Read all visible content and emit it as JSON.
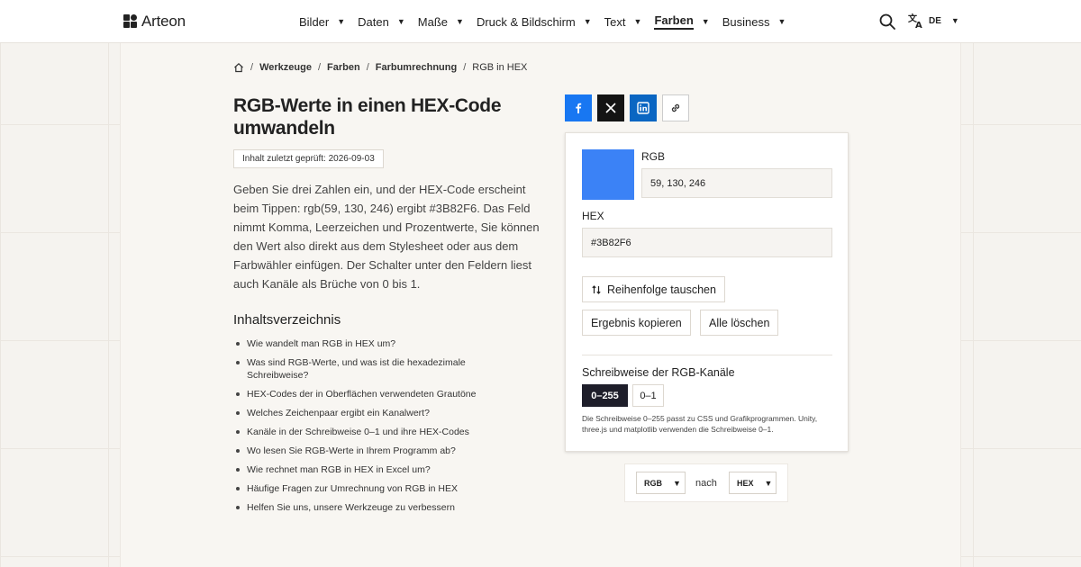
{
  "header": {
    "logo_text": "Arteon",
    "nav": [
      {
        "label": "Bilder",
        "active": false
      },
      {
        "label": "Daten",
        "active": false
      },
      {
        "label": "Maße",
        "active": false
      },
      {
        "label": "Druck & Bildschirm",
        "active": false
      },
      {
        "label": "Text",
        "active": false
      },
      {
        "label": "Farben",
        "active": true
      },
      {
        "label": "Business",
        "active": false
      }
    ],
    "search_icon": "search-icon",
    "language_icon": "translate-icon",
    "language_code": "DE"
  },
  "breadcrumb": {
    "home_icon": "home-icon",
    "items": [
      "Werkzeuge",
      "Farben",
      "Farbumrechnung"
    ],
    "current": "RGB in HEX"
  },
  "main": {
    "title": "RGB-Werte in einen HEX-Code umwandeln",
    "date_badge": "Inhalt zuletzt geprüft: 2026-09-03",
    "intro": "Geben Sie drei Zahlen ein, und der HEX-Code erscheint beim Tippen: rgb(59, 130, 246) ergibt #3B82F6. Das Feld nimmt Komma, Leerzeichen und Prozentwerte, Sie können den Wert also direkt aus dem Stylesheet oder aus dem Farbwähler einfügen. Der Schalter unter den Feldern liest auch Kanäle als Brüche von 0 bis 1.",
    "toc_title": "Inhaltsverzeichnis",
    "toc": [
      "Wie wandelt man RGB in HEX um?",
      "Was sind RGB-Werte, und was ist die hexadezimale Schreibweise?",
      "HEX-Codes der in Oberflächen verwendeten Grautöne",
      "Welches Zeichenpaar ergibt ein Kanalwert?",
      "Kanäle in der Schreibweise 0–1 und ihre HEX-Codes",
      "Wo lesen Sie RGB-Werte in Ihrem Programm ab?",
      "Wie rechnet man RGB in HEX in Excel um?",
      "Häufige Fragen zur Umrechnung von RGB in HEX",
      "Helfen Sie uns, unsere Werkzeuge zu verbessern"
    ]
  },
  "share": {
    "icons": [
      "facebook-icon",
      "x-icon",
      "linkedin-icon",
      "link-icon"
    ]
  },
  "tool": {
    "swatch_color": "#3B82F6",
    "rgb_label": "RGB",
    "rgb_value": "59, 130, 246",
    "hex_label": "HEX",
    "hex_value": "#3B82F6",
    "swap_icon": "swap-icon",
    "swap_label": "Reihenfolge tauschen",
    "copy_label": "Ergebnis kopieren",
    "clear_label": "Alle löschen",
    "notation_title": "Schreibweise der RGB-Kanäle",
    "notation_options": [
      "0–255",
      "0–1"
    ],
    "notation_selected": "0–255",
    "notation_hint": "Die Schreibweise 0–255 passt zu CSS und Grafikprogrammen. Unity, three.js und matplotlib verwenden die Schreibweise 0–1."
  },
  "converter": {
    "from": "RGB",
    "connector": "nach",
    "to": "HEX"
  },
  "colors": {
    "accent_dark": "#1E1E2A",
    "facebook": "#1877F2",
    "x": "#141414",
    "linkedin": "#0A66C2"
  }
}
